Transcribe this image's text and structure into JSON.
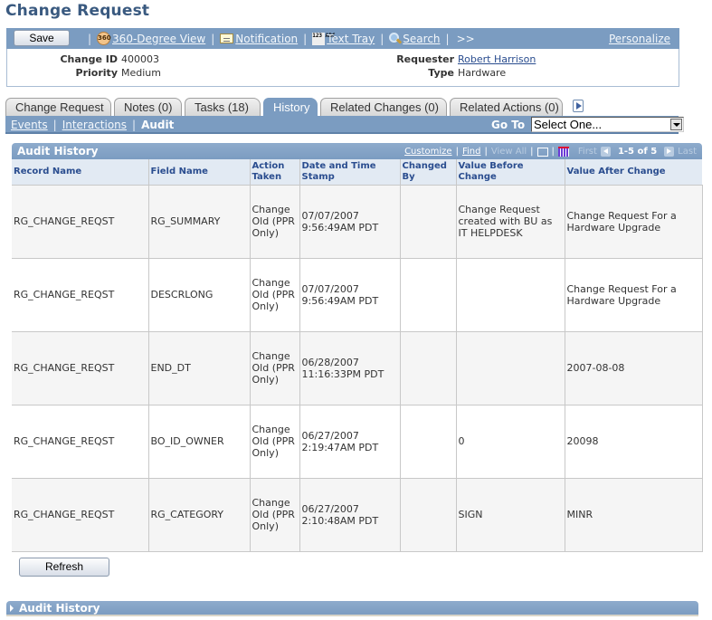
{
  "page": {
    "title": "Change Request"
  },
  "toolbar": {
    "save_label": "Save",
    "items": [
      {
        "icon": "360-icon",
        "label": "360-Degree View"
      },
      {
        "icon": "notification-icon",
        "label": "Notification"
      },
      {
        "icon": "text-tray-icon",
        "label": "Text Tray"
      },
      {
        "icon": "search-icon",
        "label": "Search"
      }
    ],
    "more_label": ">>",
    "personalize_label": "Personalize",
    "icon_360_text": "360",
    "icon_tray_text": "123 ABC"
  },
  "info": {
    "change_id_label": "Change ID",
    "change_id": "400003",
    "priority_label": "Priority",
    "priority": "Medium",
    "requester_label": "Requester",
    "requester": "Robert Harrison",
    "type_label": "Type",
    "type": "Hardware"
  },
  "tabs": [
    {
      "label": "Change Request",
      "active": false
    },
    {
      "label": "Notes (0)",
      "active": false
    },
    {
      "label": "Tasks (18)",
      "active": false
    },
    {
      "label": "History",
      "active": true
    },
    {
      "label": "Related Changes (0)",
      "active": false
    },
    {
      "label": "Related Actions (0)",
      "active": false
    }
  ],
  "subnav": {
    "events": "Events",
    "interactions": "Interactions",
    "audit": "Audit",
    "goto_label": "Go To",
    "goto_value": "Select One..."
  },
  "grid": {
    "title": "Audit History",
    "customize": "Customize",
    "find": "Find",
    "view_all": "View All",
    "first": "First",
    "range": "1-5 of 5",
    "last": "Last",
    "columns": [
      "Record Name",
      "Field Name",
      "Action Taken",
      "Date and Time Stamp",
      "Changed By",
      "Value Before Change",
      "Value After Change"
    ],
    "rows": [
      [
        "RG_CHANGE_REQST",
        "RG_SUMMARY",
        "Change Old (PPR Only)",
        "07/07/2007 9:56:49AM PDT",
        "",
        "Change Request created with BU as IT HELPDESK",
        "Change Request For a Hardware Upgrade"
      ],
      [
        "RG_CHANGE_REQST",
        "DESCRLONG",
        "Change Old (PPR Only)",
        "07/07/2007 9:56:49AM PDT",
        "",
        "",
        "Change Request For a Hardware Upgrade"
      ],
      [
        "RG_CHANGE_REQST",
        "END_DT",
        "Change Old (PPR Only)",
        "06/28/2007 11:16:33PM PDT",
        "",
        "",
        "2007-08-08"
      ],
      [
        "RG_CHANGE_REQST",
        "BO_ID_OWNER",
        "Change Old (PPR Only)",
        "06/27/2007 2:19:47AM PDT",
        "",
        "0",
        "20098"
      ],
      [
        "RG_CHANGE_REQST",
        "RG_CATEGORY",
        "Change Old (PPR Only)",
        "06/27/2007 2:10:48AM PDT",
        "",
        "SIGN",
        "MINR"
      ]
    ]
  },
  "refresh_label": "Refresh",
  "collapsed_section": {
    "title": "Audit History"
  }
}
